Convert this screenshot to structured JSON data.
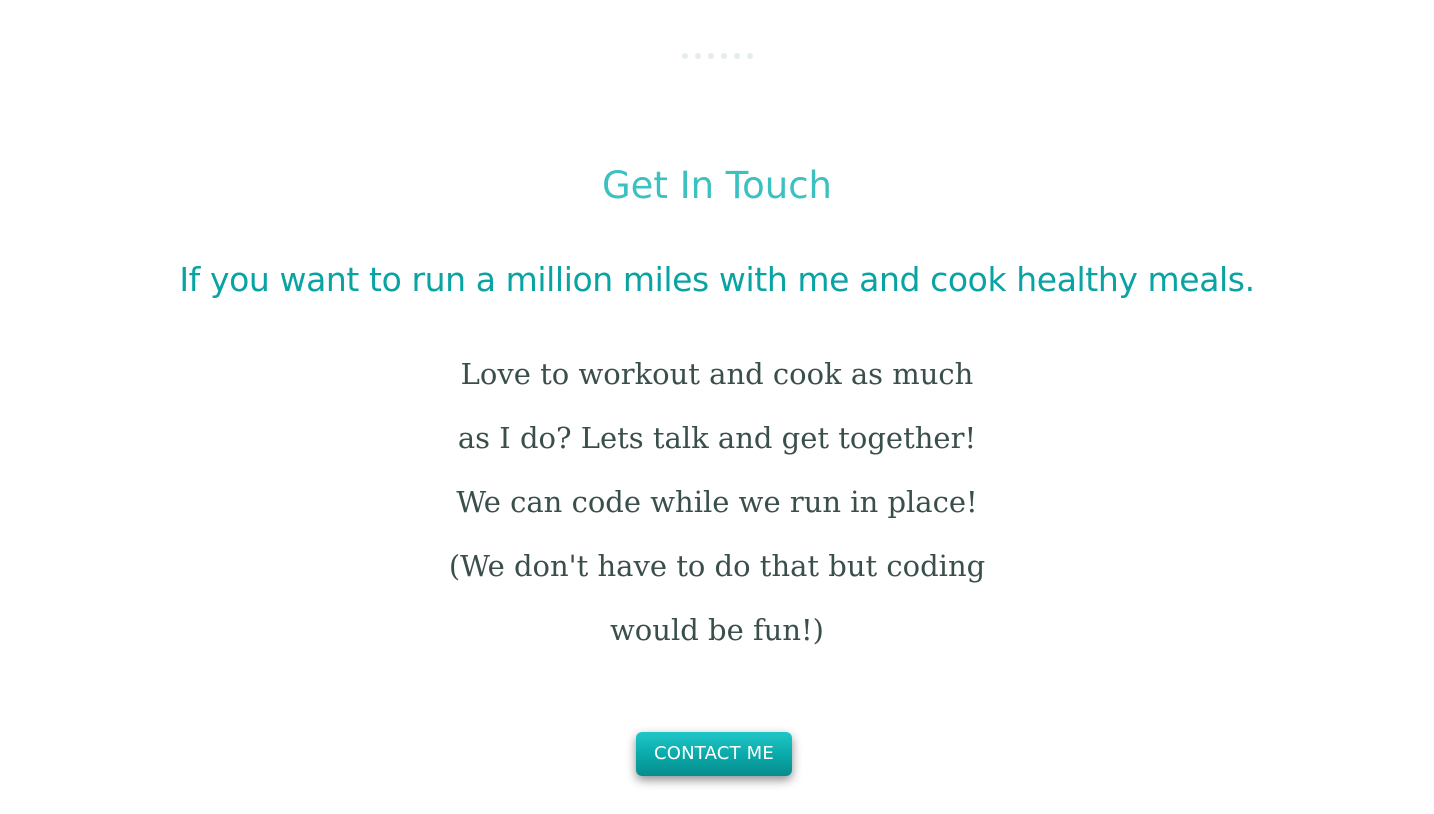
{
  "colors": {
    "title": "#3cc1c1",
    "subtitle": "#0aa3a3",
    "body_text": "#3a4f4b",
    "button_bg": "#0aa8a8",
    "button_text": "#ffffff",
    "dots": "#e4ecec"
  },
  "loader": {
    "icon": "loading-dots-icon"
  },
  "section": {
    "title": "Get In Touch",
    "subtitle": "If you want to run a million miles with me and cook healthy meals.",
    "body_lines": [
      "Love to workout and cook as much",
      "as I do? Lets talk and get together!",
      "We can code while we run in place!",
      "(We don't have to do that but coding",
      "would be fun!)"
    ],
    "button_label": "CONTACT ME"
  }
}
